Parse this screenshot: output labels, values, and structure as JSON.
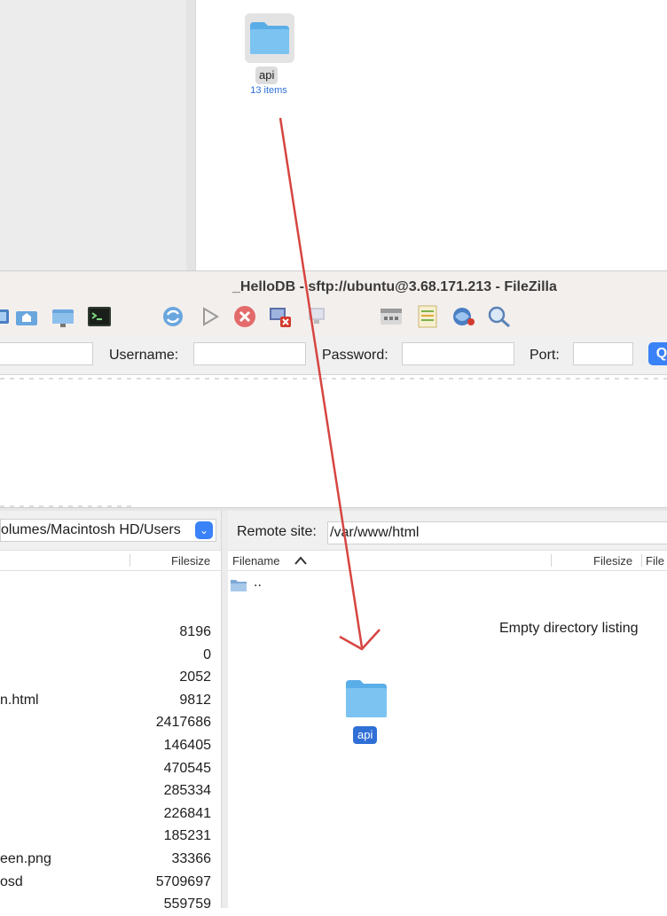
{
  "finder": {
    "folder_name": "api",
    "folder_count": "13 items"
  },
  "filezilla": {
    "title": "_HelloDB - sftp://ubuntu@3.68.171.213 - FileZilla",
    "toolbar_icons": [
      "site-manager-icon",
      "home-folder-icon",
      "local-folder-icon",
      "terminal-icon",
      "refresh-icon",
      "process-queue-icon",
      "cancel-icon",
      "disconnect-icon",
      "reconnect-icon",
      "filter-icon",
      "compare-icon",
      "sync-browse-icon",
      "search-icon"
    ],
    "quickconnect": {
      "username_label": "Username:",
      "password_label": "Password:",
      "port_label": "Port:",
      "connect_glyph": "Q"
    },
    "local": {
      "path": "olumes/Macintosh HD/Users",
      "col_filesize": "Filesize",
      "rows": [
        {
          "name": "",
          "size": "8196"
        },
        {
          "name": "",
          "size": "0"
        },
        {
          "name": "",
          "size": "2052"
        },
        {
          "name": "n.html",
          "size": "9812"
        },
        {
          "name": "",
          "size": "2417686"
        },
        {
          "name": "",
          "size": "146405"
        },
        {
          "name": "",
          "size": "470545"
        },
        {
          "name": "",
          "size": "285334"
        },
        {
          "name": "",
          "size": "226841"
        },
        {
          "name": "",
          "size": "185231"
        },
        {
          "name": "een.png",
          "size": "33366"
        },
        {
          "name": "osd",
          "size": "5709697"
        },
        {
          "name": "",
          "size": "559759"
        }
      ]
    },
    "remote": {
      "label": "Remote site:",
      "path": "/var/www/html",
      "col_filename": "Filename",
      "col_filesize": "Filesize",
      "col_filetype": "File",
      "parent": "..",
      "empty": "Empty directory listing"
    },
    "drag_folder_name": "api"
  },
  "colors": {
    "accent": "#3a82f7",
    "arrow": "#d64541",
    "folder": "#6fb9f0"
  }
}
